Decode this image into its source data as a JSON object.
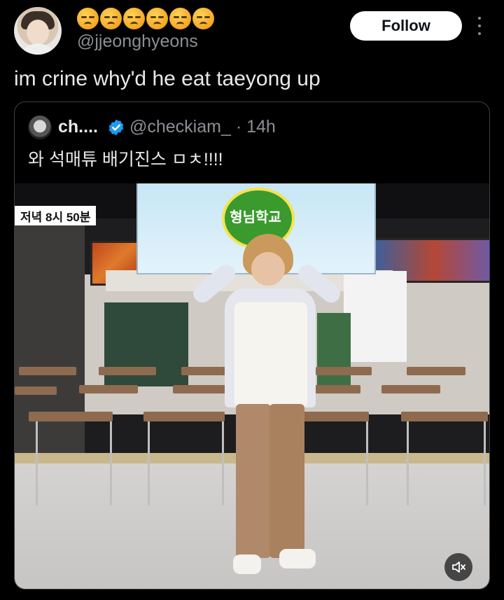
{
  "header": {
    "display_name_emoji": [
      "😔",
      "😔",
      "😔",
      "😔",
      "😔",
      "😔"
    ],
    "handle": "@jjeonghyeons",
    "follow_label": "Follow"
  },
  "tweet": {
    "text": "im crine why'd he eat taeyong up"
  },
  "quoted_tweet": {
    "name": "ch....",
    "handle_time": "@checkiam_ · 14h",
    "text": "와 석매튜 배기진스 ㅁㅊ!!!!",
    "video": {
      "channel_badge": "저녁 8시 50분",
      "logo_text": "형님학교",
      "muted": true
    }
  },
  "colors": {
    "background": "#000000",
    "text_primary": "#e7e9ea",
    "text_secondary": "#8b8f94",
    "verified": "#1d9bf0",
    "follow_button_bg": "#ffffff"
  },
  "icons": {
    "verified": "verified-badge-icon",
    "more": "more-vertical-icon",
    "mute": "speaker-muted-icon"
  }
}
